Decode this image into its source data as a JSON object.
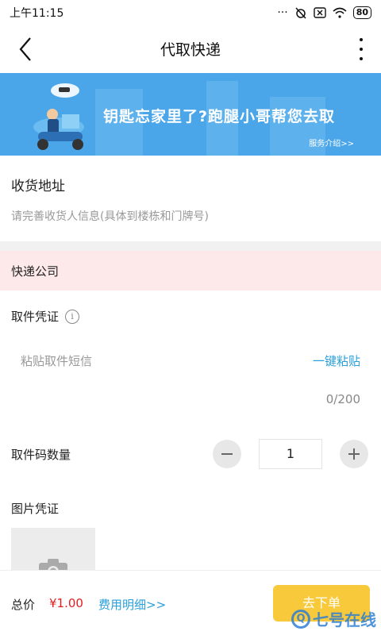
{
  "status_bar": {
    "time": "上午11:15",
    "battery": "80"
  },
  "nav": {
    "title": "代取快递",
    "back_icon": "back-arrow-icon",
    "more_icon": "more-vertical-icon"
  },
  "banner": {
    "headline": "钥匙忘家里了?跑腿小哥帮您去取",
    "link": "服务介绍>>",
    "bg_color": "#4aa6e8"
  },
  "address": {
    "title": "收货地址",
    "placeholder": "请完善收货人信息(具体到楼栋和门牌号)"
  },
  "courier": {
    "label": "快递公司"
  },
  "proof": {
    "title": "取件凭证",
    "info_icon": "info-icon",
    "sms_placeholder": "粘贴取件短信",
    "paste_link": "一键粘贴",
    "counter": "0/200"
  },
  "quantity": {
    "label": "取件码数量",
    "value": "1"
  },
  "photo": {
    "title": "图片凭证",
    "icon": "camera-icon"
  },
  "footer": {
    "total_label": "总价",
    "total_price": "¥1.00",
    "fee_detail": "费用明细>>",
    "order_button": "去下单",
    "accent_color": "#f8c93a",
    "price_color": "#e02020",
    "link_color": "#2a9fd8"
  },
  "watermark": {
    "text": "七号在线",
    "logo_letter": "Q"
  }
}
